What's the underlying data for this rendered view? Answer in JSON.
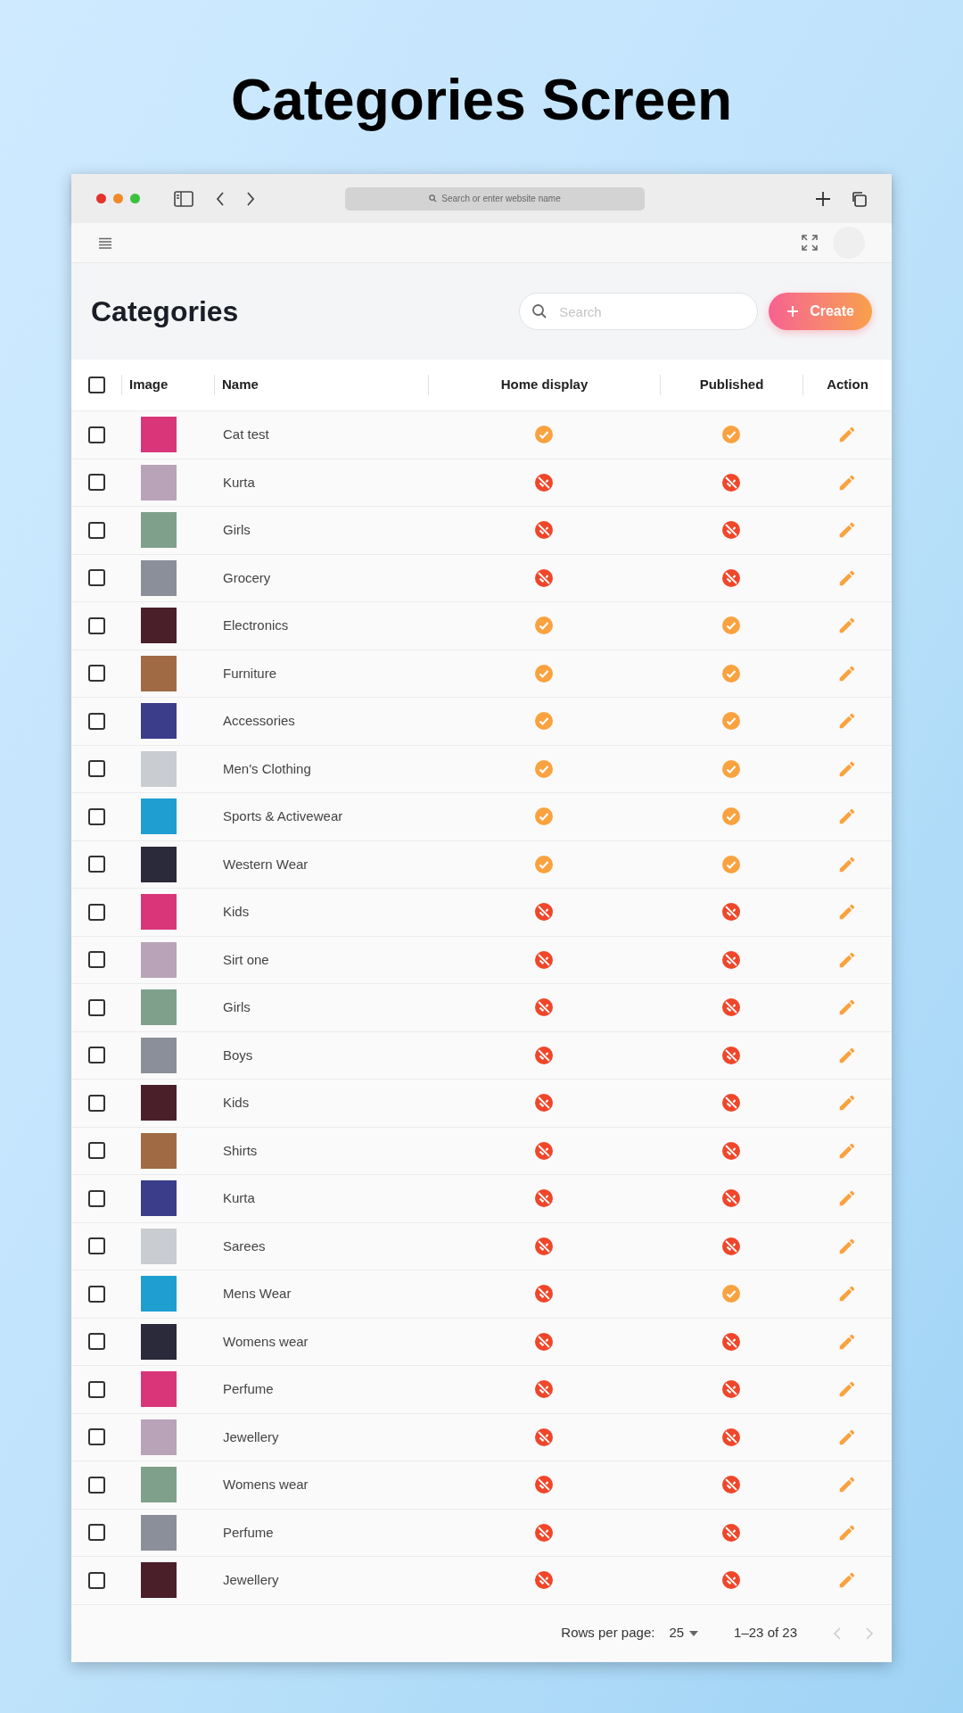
{
  "headline": "Categories Screen",
  "browser": {
    "address_placeholder": "Search or enter website name"
  },
  "page": {
    "title": "Categories",
    "search": {
      "placeholder": "Search"
    },
    "create_button": "Create"
  },
  "table": {
    "select_all": {
      "checked": false
    },
    "columns": [
      "Image",
      "Name",
      "Home display",
      "Published",
      "Action"
    ],
    "rows": [
      {
        "name": "Cat test",
        "checked": false,
        "home_display": true,
        "published": true
      },
      {
        "name": "Kurta",
        "checked": false,
        "home_display": false,
        "published": false
      },
      {
        "name": "Girls",
        "checked": false,
        "home_display": false,
        "published": false
      },
      {
        "name": "Grocery",
        "checked": false,
        "home_display": false,
        "published": false
      },
      {
        "name": "Electronics",
        "checked": false,
        "home_display": true,
        "published": true
      },
      {
        "name": "Furniture",
        "checked": false,
        "home_display": true,
        "published": true
      },
      {
        "name": "Accessories",
        "checked": false,
        "home_display": true,
        "published": true
      },
      {
        "name": "Men's Clothing",
        "checked": false,
        "home_display": true,
        "published": true
      },
      {
        "name": "Sports & Activewear",
        "checked": false,
        "home_display": true,
        "published": true
      },
      {
        "name": "Western Wear",
        "checked": false,
        "home_display": true,
        "published": true
      },
      {
        "name": "Kids",
        "checked": false,
        "home_display": false,
        "published": false
      },
      {
        "name": "Sirt one",
        "checked": false,
        "home_display": false,
        "published": false
      },
      {
        "name": "Girls",
        "checked": false,
        "home_display": false,
        "published": false
      },
      {
        "name": "Boys",
        "checked": false,
        "home_display": false,
        "published": false
      },
      {
        "name": "Kids",
        "checked": false,
        "home_display": false,
        "published": false
      },
      {
        "name": "Shirts",
        "checked": false,
        "home_display": false,
        "published": false
      },
      {
        "name": "Kurta",
        "checked": false,
        "home_display": false,
        "published": false
      },
      {
        "name": "Sarees",
        "checked": false,
        "home_display": false,
        "published": false
      },
      {
        "name": "Mens Wear",
        "checked": false,
        "home_display": false,
        "published": true
      },
      {
        "name": "Womens wear",
        "checked": false,
        "home_display": false,
        "published": false
      },
      {
        "name": "Perfume",
        "checked": false,
        "home_display": false,
        "published": false
      },
      {
        "name": "Jewellery",
        "checked": false,
        "home_display": false,
        "published": false
      },
      {
        "name": "Womens wear",
        "checked": false,
        "home_display": false,
        "published": false
      },
      {
        "name": "Perfume",
        "checked": false,
        "home_display": false,
        "published": false
      },
      {
        "name": "Jewellery",
        "checked": false,
        "home_display": false,
        "published": false
      }
    ]
  },
  "pagination": {
    "rows_per_page_label": "Rows per page:",
    "rows_per_page": "25",
    "range": "1–23 of 23"
  }
}
